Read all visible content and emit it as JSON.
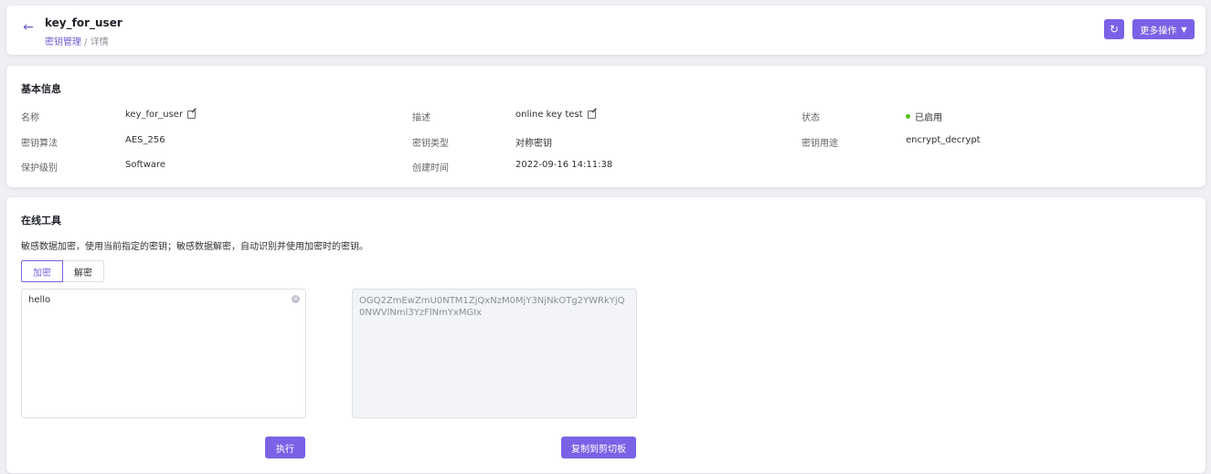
{
  "header": {
    "back_icon": "←",
    "title": "key_for_user",
    "breadcrumb_parent": "密钥管理",
    "breadcrumb_sep": " / ",
    "breadcrumb_current": "详情",
    "refresh_icon": "↻",
    "more_label": "更多操作",
    "more_caret": "▼"
  },
  "basic_info": {
    "title": "基本信息",
    "fields": {
      "name_label": "名称",
      "name_value": "key_for_user",
      "desc_label": "描述",
      "desc_value": "online key test",
      "status_label": "状态",
      "status_value": "已启用",
      "algo_label": "密钥算法",
      "algo_value": "AES_256",
      "type_label": "密钥类型",
      "type_value": "对称密钥",
      "usage_label": "密钥用途",
      "usage_value": "encrypt_decrypt",
      "protect_label": "保护级别",
      "protect_value": "Software",
      "created_label": "创建时间",
      "created_value": "2022-09-16 14:11:38"
    }
  },
  "tools": {
    "title": "在线工具",
    "description": "敏感数据加密，使用当前指定的密钥；敏感数据解密，自动识别并使用加密时的密钥。",
    "tab_encrypt": "加密",
    "tab_decrypt": "解密",
    "input_value": "hello",
    "clear_icon": "×",
    "output_value": "OGQ2ZmEwZmU0NTM1ZjQxNzM0MjY3NjNkOTg2YWRkYjQ0NWVlNml3YzFlNmYxMGIx",
    "exec_label": "执行",
    "copy_label": "复制到剪切板"
  },
  "colors": {
    "accent": "#7b61e6",
    "status_green": "#52c41a"
  }
}
